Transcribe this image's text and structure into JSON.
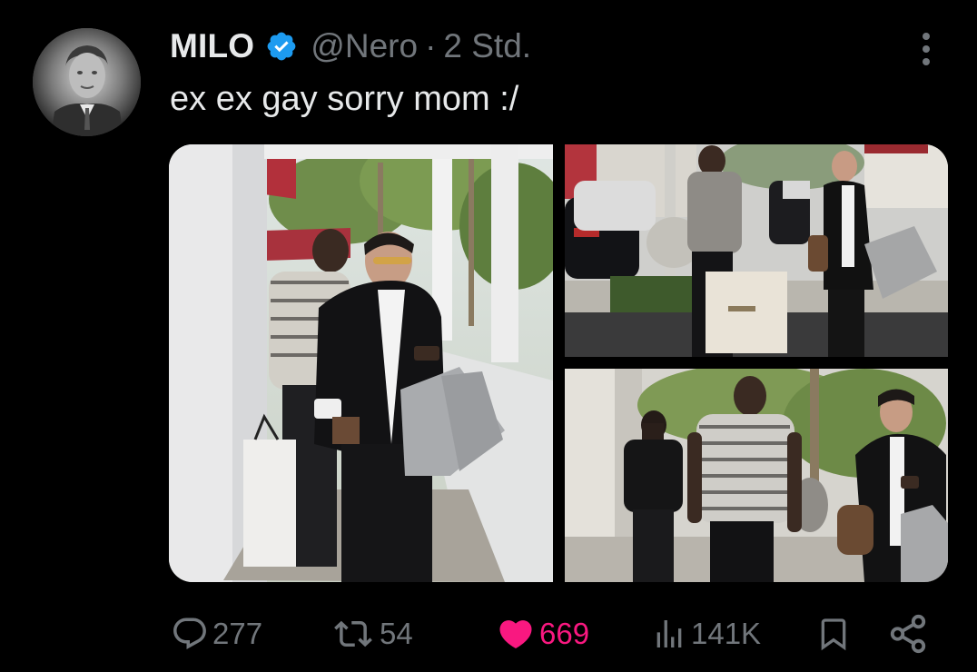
{
  "user": {
    "display_name": "MILO",
    "handle": "@Nero",
    "separator": "·",
    "time": "2 Std.",
    "verified": true,
    "verified_color": "#1d9bf0"
  },
  "tweet": {
    "text": "ex ex gay sorry mom :/"
  },
  "media": {
    "count": 3,
    "photos": [
      {
        "name": "photo-street-shopping-bags"
      },
      {
        "name": "photo-sidewalk-ysl-bag"
      },
      {
        "name": "photo-walking-phone"
      }
    ]
  },
  "actions": {
    "replies": "277",
    "reposts": "54",
    "likes": "669",
    "views": "141K",
    "liked": true,
    "like_color": "#f91880",
    "muted_color": "#71767b"
  },
  "icons": {
    "reply": "speech-bubble-icon",
    "repost": "repost-arrows-icon",
    "like": "heart-icon",
    "views": "bar-chart-icon",
    "bookmark": "bookmark-icon",
    "share": "share-nodes-icon",
    "more": "more-dots-icon",
    "verified": "verified-badge-icon"
  }
}
